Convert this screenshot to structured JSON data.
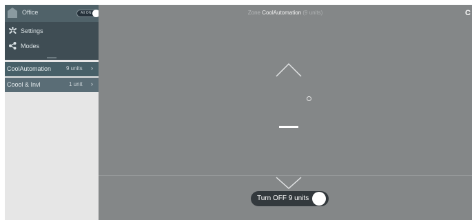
{
  "sidebar": {
    "header": {
      "title": "Office",
      "toggle_label": "All ON"
    },
    "menu": [
      {
        "label": "Settings",
        "icon": "settings-icon"
      },
      {
        "label": "Modes",
        "icon": "modes-icon"
      }
    ],
    "zones": [
      {
        "name": "CoolAutomation",
        "count": "9 units",
        "chevron": "›",
        "selected": true
      },
      {
        "name": "Coool & Invl",
        "count": "1 unit",
        "chevron": "›",
        "selected": false
      }
    ]
  },
  "main": {
    "title_prefix": "Zone",
    "zone_name": "CoolAutomation",
    "zone_count": "(9 units)",
    "edge_glyph": "C",
    "setpoint": "—",
    "turn_off_label": "Turn OFF 9 units"
  },
  "colors": {
    "sidebar_header": "#506269",
    "sidebar_menu": "#3f4d54",
    "zone_row": "#5a6d76",
    "main_bg": "#848788",
    "toggle_bg": "#33393d"
  }
}
